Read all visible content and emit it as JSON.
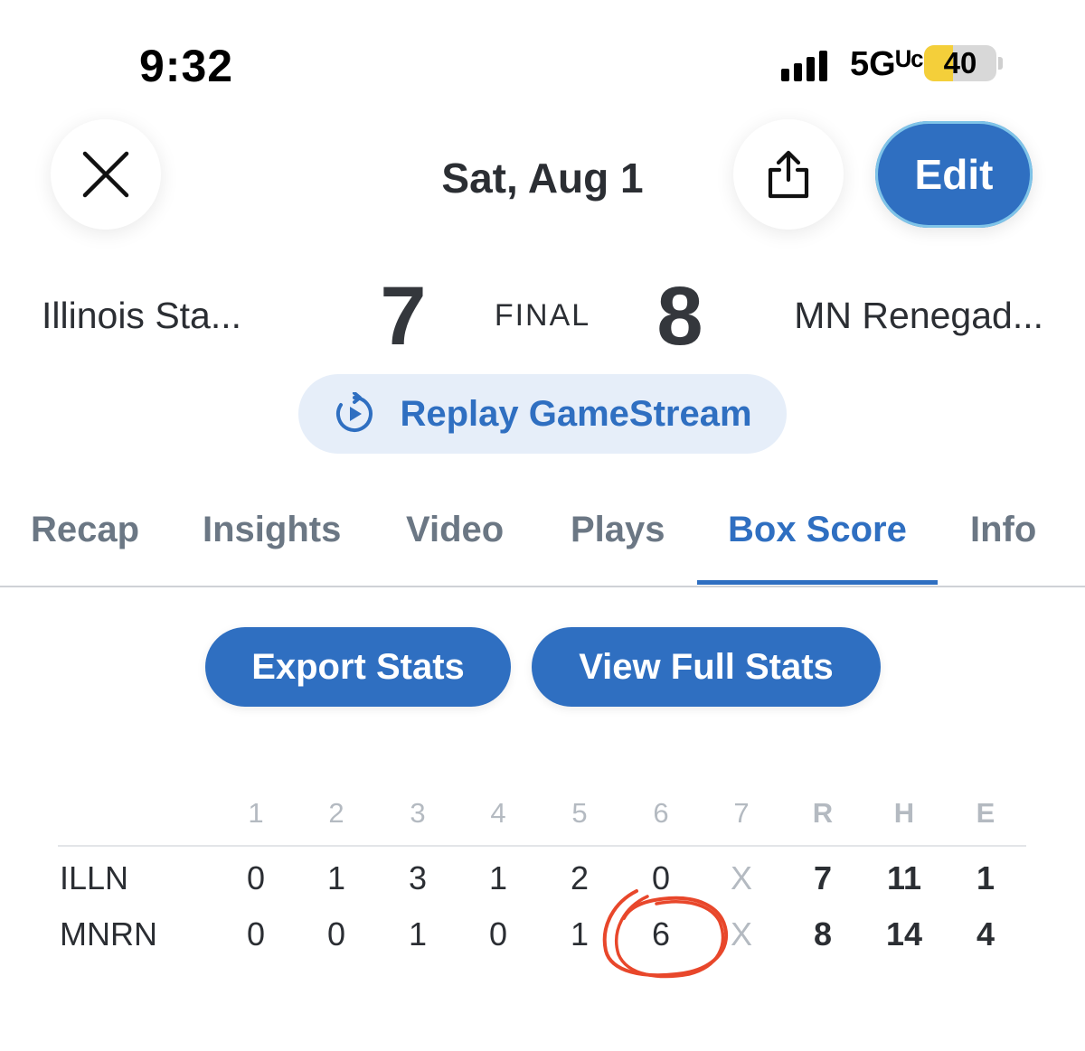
{
  "status_bar": {
    "time": "9:32",
    "network": "5Gᵁᶜ",
    "battery_level": "40",
    "battery_fraction": 0.4
  },
  "header": {
    "close_icon": "close-icon",
    "date": "Sat, Aug 1",
    "share_icon": "share-icon",
    "edit_label": "Edit"
  },
  "scoreboard": {
    "away_team": "Illinois Sta...",
    "away_score": "7",
    "status": "FINAL",
    "home_score": "8",
    "home_team": "MN Renegad..."
  },
  "replay": {
    "label": "Replay GameStream",
    "icon": "replay-icon"
  },
  "tabs": [
    "Recap",
    "Insights",
    "Video",
    "Plays",
    "Box Score",
    "Info"
  ],
  "active_tab": "Box Score",
  "actions": {
    "export_label": "Export Stats",
    "full_stats_label": "View Full Stats"
  },
  "box_score": {
    "headers": [
      "1",
      "2",
      "3",
      "4",
      "5",
      "6",
      "7",
      "R",
      "H",
      "E"
    ],
    "rows": [
      {
        "team": "ILLN",
        "innings": [
          "0",
          "1",
          "3",
          "1",
          "2",
          "0",
          "X"
        ],
        "R": "7",
        "H": "11",
        "E": "1"
      },
      {
        "team": "MNRN",
        "innings": [
          "0",
          "0",
          "1",
          "0",
          "1",
          "6",
          "X"
        ],
        "R": "8",
        "H": "14",
        "E": "4"
      }
    ]
  },
  "colors": {
    "accent": "#2f6fc1",
    "replay_bg": "#e6eef9",
    "annotation": "#e8472b",
    "battery": "#f4cf3a"
  }
}
